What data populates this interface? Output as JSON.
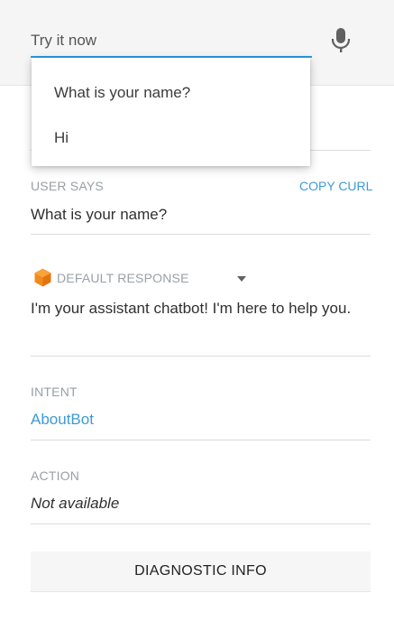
{
  "input": {
    "placeholder": "Try it now",
    "value": ""
  },
  "mic_icon": "microphone-icon",
  "suggestions": [
    "What is your name?",
    "Hi"
  ],
  "user_says": {
    "label": "USER SAYS",
    "copy_curl": "COPY CURL",
    "value": "What is your name?"
  },
  "response": {
    "icon": "cube-icon",
    "label": "DEFAULT RESPONSE",
    "text": "I'm your assistant chatbot! I'm here to help you."
  },
  "intent": {
    "label": "INTENT",
    "value": "AboutBot"
  },
  "action": {
    "label": "ACTION",
    "value": "Not available"
  },
  "diagnostic_button": "DIAGNOSTIC INFO",
  "colors": {
    "accent": "#2a9ae0",
    "link": "#3d9ad8",
    "cube": "#f28b1c"
  }
}
